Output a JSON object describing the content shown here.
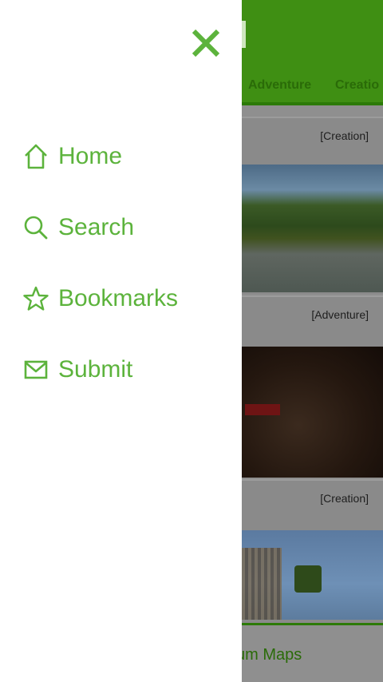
{
  "background_app": {
    "tabs": [
      "Adventure",
      "Creatio"
    ],
    "cards": [
      {
        "tag": "[Creation]"
      },
      {
        "tag": "[Adventure]"
      },
      {
        "tag": "[Creation]"
      }
    ],
    "bottom_bar_label": "um Maps"
  },
  "drawer": {
    "close_icon": "close-x-icon",
    "items": [
      {
        "label": "Home",
        "icon": "home-icon"
      },
      {
        "label": "Search",
        "icon": "search-icon"
      },
      {
        "label": "Bookmarks",
        "icon": "star-icon"
      },
      {
        "label": "Submit",
        "icon": "envelope-icon"
      }
    ]
  },
  "colors": {
    "accent_green": "#5cb33c",
    "header_green_dimmed": "#3f8f13",
    "overlay_gray": "#8f8f8f"
  }
}
